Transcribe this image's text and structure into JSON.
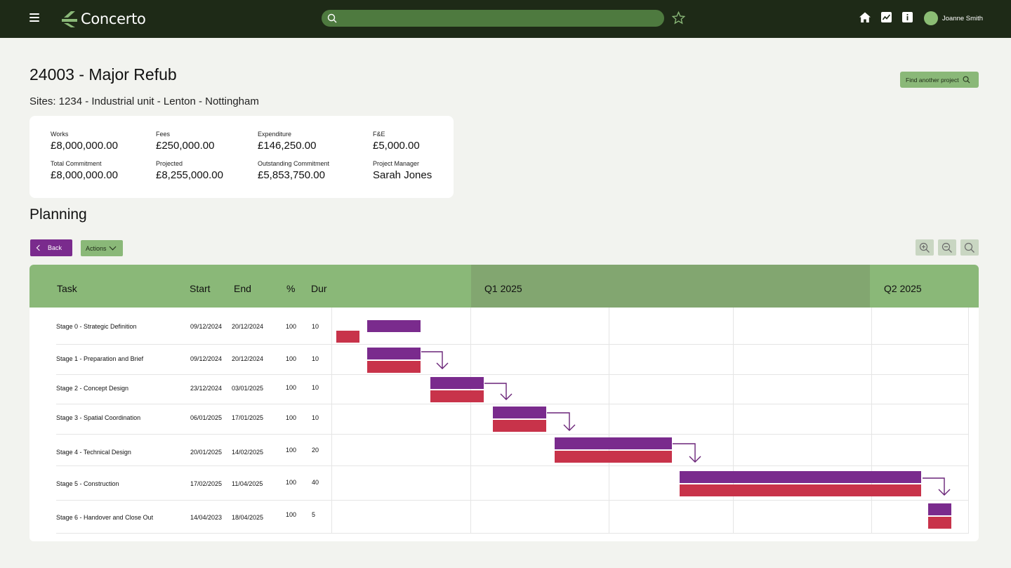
{
  "app": {
    "name": "Concerto"
  },
  "user": {
    "name": "Joanne Smith"
  },
  "header": {
    "title": "24003 - Major Refub",
    "sites": "Sites: 1234 - Industrial unit - Lenton - Nottingham",
    "find_label": "Find another project"
  },
  "summary": {
    "works_label": "Works",
    "works_value": "£8,000,000.00",
    "fees_label": "Fees",
    "fees_value": "£250,000.00",
    "expenditure_label": "Expenditure",
    "expenditure_value": "£146,250.00",
    "fe_label": "F&E",
    "fe_value": "£5,000.00",
    "total_label": "Total Commitment",
    "total_value": "£8,000,000.00",
    "projected_label": "Projected",
    "projected_value": "£8,255,000.00",
    "outstanding_label": "Outstanding Commitment",
    "outstanding_value": "£5,853,750.00",
    "pm_label": "Project Manager",
    "pm_value": "Sarah Jones"
  },
  "planning": {
    "title": "Planning",
    "back_label": "Back",
    "actions_label": "Actions"
  },
  "gantt": {
    "columns": {
      "task": "Task",
      "start": "Start",
      "end": "End",
      "pct": "%",
      "dur": "Dur"
    },
    "quarters": [
      "Q1 2025",
      "Q2 2025"
    ],
    "tasks": [
      {
        "name": "Stage 0 - Strategic Definition",
        "start": "09/12/2024",
        "end": "20/12/2024",
        "pct": "100",
        "dur": "10"
      },
      {
        "name": "Stage 1 - Preparation and Brief",
        "start": "09/12/2024",
        "end": "20/12/2024",
        "pct": "100",
        "dur": "10"
      },
      {
        "name": "Stage 2 - Concept Design",
        "start": "23/12/2024",
        "end": "03/01/2025",
        "pct": "100",
        "dur": "10"
      },
      {
        "name": "Stage 3 - Spatial Coordination",
        "start": "06/01/2025",
        "end": "17/01/2025",
        "pct": "100",
        "dur": "10"
      },
      {
        "name": "Stage 4 - Technical Design",
        "start": "20/01/2025",
        "end": "14/02/2025",
        "pct": "100",
        "dur": "20"
      },
      {
        "name": "Stage 5 - Construction",
        "start": "17/02/2025",
        "end": "11/04/2025",
        "pct": "100",
        "dur": "40"
      },
      {
        "name": "Stage 6 - Handover and Close Out",
        "start": "14/04/2023",
        "end": "18/04/2025",
        "pct": "100",
        "dur": "5"
      }
    ]
  },
  "colors": {
    "topbar": "#1e2a17",
    "accent": "#8ab878",
    "planned": "#7a2b8d",
    "actual": "#c8334a"
  },
  "icons": [
    "menu-icon",
    "search-icon",
    "star-icon",
    "home-icon",
    "chart-icon",
    "info-icon",
    "zoom-in-icon",
    "zoom-out-icon",
    "zoom-fit-icon"
  ]
}
